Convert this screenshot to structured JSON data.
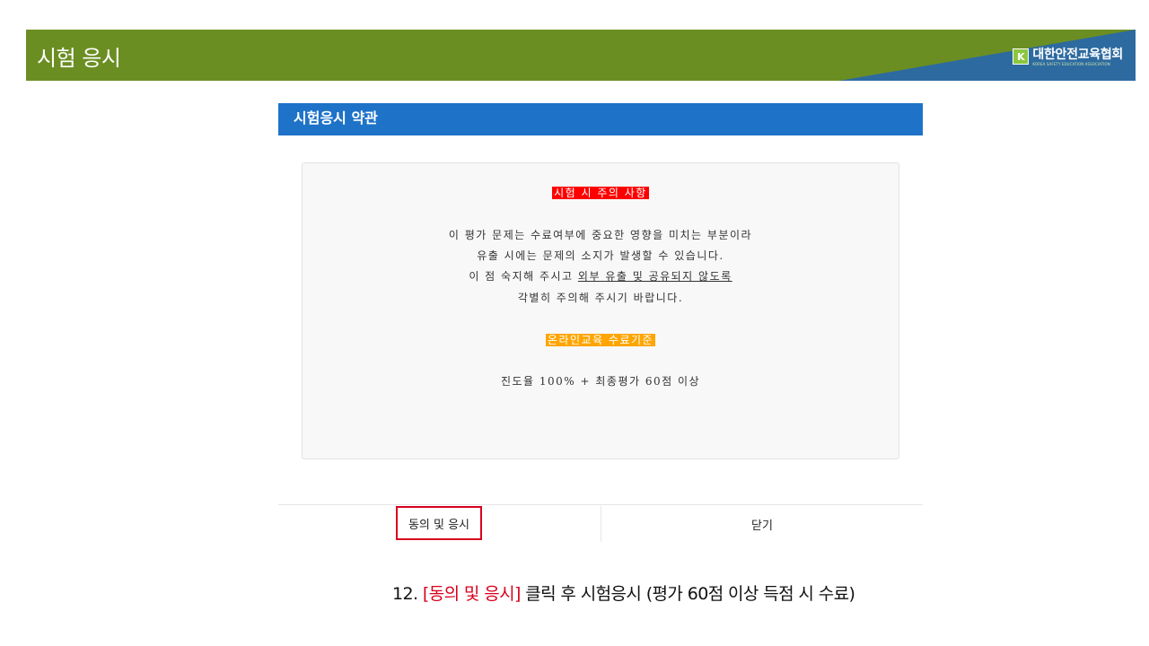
{
  "header": {
    "title": "시험 응시",
    "logo_mark": "K",
    "logo_name": "대한안전교육협회",
    "logo_sub": "KOREA SAFETY EDUCATION ASSOCIATION"
  },
  "dialog": {
    "title": "시험응시 약관",
    "caution_heading": "시험 시 주의 사항",
    "caution_lines": [
      "이 평가 문제는 수료여부에 중요한 영향을 미치는 부분이라",
      "유출 시에는 문제의 소지가 발생할 수 있습니다.",
      "이 점 숙지해 주시고",
      "외부 유출 및 공유되지 않도록",
      "각별히 주의해 주시기 바랍니다."
    ],
    "criteria_heading": "온라인교육 수료기준",
    "criteria_text": "진도율 100% + 최종평가 60점 이상",
    "agree_button": "동의 및 응시",
    "close_button": "닫기"
  },
  "caption": {
    "step": "12.",
    "highlight": "[동의 및 응시]",
    "rest": "클릭 후 시험응시 (평가 60점 이상 득점 시 수료)"
  },
  "colors": {
    "header_green": "#6b8e23",
    "header_blue": "#2c6aa0",
    "dialog_header": "#1e73c8",
    "highlight_red": "#ff0000",
    "highlight_orange": "#ffa500",
    "agree_outline": "#d9001b"
  }
}
